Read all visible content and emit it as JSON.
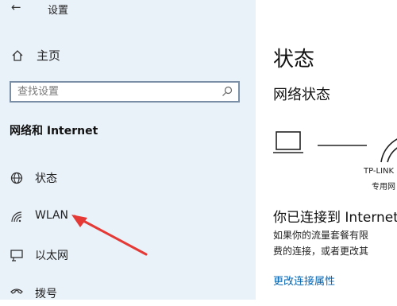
{
  "window": {
    "title": "设置"
  },
  "sidebar": {
    "home_label": "主页",
    "search_placeholder": "查找设置",
    "section_title": "网络和 Internet",
    "items": [
      {
        "label": "状态",
        "icon": "globe-icon"
      },
      {
        "label": "WLAN",
        "icon": "wifi-icon"
      },
      {
        "label": "以太网",
        "icon": "ethernet-icon"
      },
      {
        "label": "拨号",
        "icon": "dialup-icon"
      }
    ]
  },
  "main": {
    "title": "状态",
    "subtitle": "网络状态",
    "network_name": "TP-LINK",
    "network_type": "专用网",
    "connected_text": "你已连接到 Internet",
    "desc_line1": "如果你的流量套餐有限",
    "desc_line2": "费的连接，或者更改其",
    "link_text": "更改连接属性"
  },
  "colors": {
    "sidebar_bg": "#e9f1f9",
    "accent_link": "#0063b1",
    "annotation_arrow": "#e53935"
  }
}
